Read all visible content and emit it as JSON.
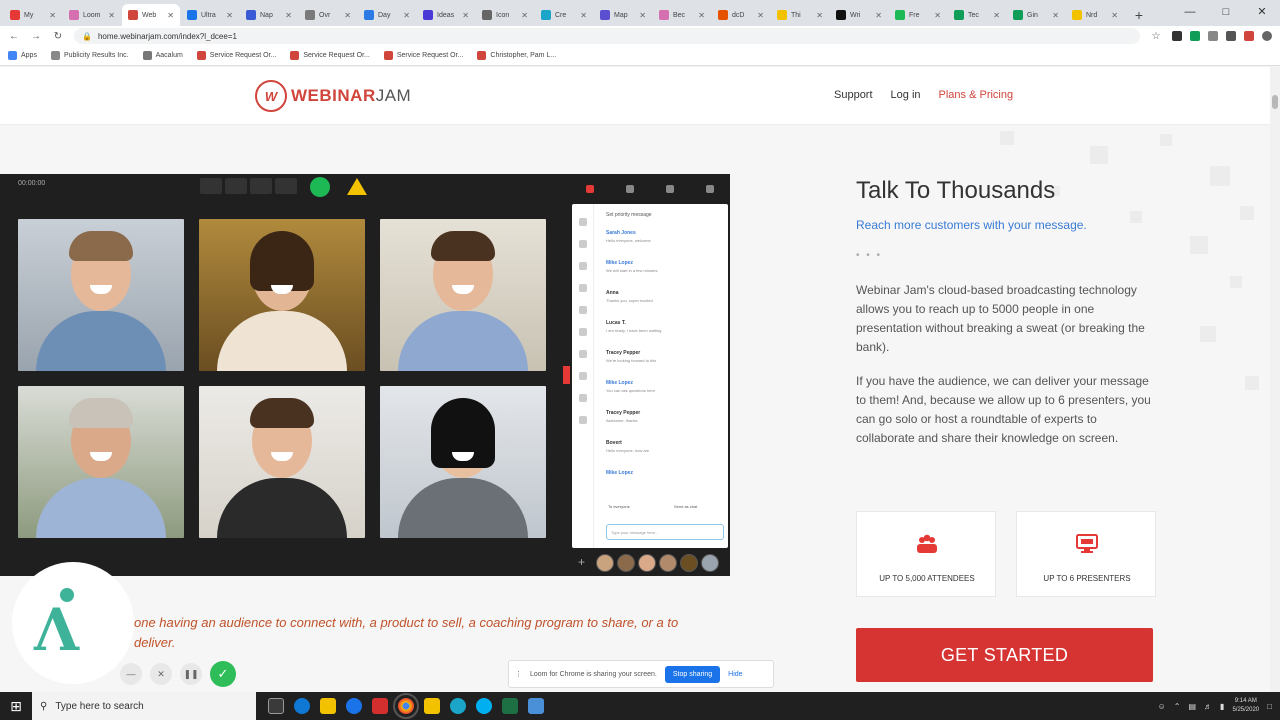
{
  "browser": {
    "tabs": [
      {
        "label": "My",
        "color": "#e53935"
      },
      {
        "label": "Loom",
        "color": "#d66fb0"
      },
      {
        "label": "Web",
        "color": "#d0453c",
        "active": true
      },
      {
        "label": "Ultra",
        "color": "#1a73e8"
      },
      {
        "label": "Nap",
        "color": "#3a5bd5"
      },
      {
        "label": "Ovr",
        "color": "#7a7a7a"
      },
      {
        "label": "Day",
        "color": "#2c7be5"
      },
      {
        "label": "Ideas",
        "color": "#4a3ad5"
      },
      {
        "label": "Icon",
        "color": "#666666"
      },
      {
        "label": "Cre",
        "color": "#1aa5c9"
      },
      {
        "label": "Map",
        "color": "#5a4fcf"
      },
      {
        "label": "Bec",
        "color": "#d66fb0"
      },
      {
        "label": "dcD",
        "color": "#e65100"
      },
      {
        "label": "Thi",
        "color": "#f2c200"
      },
      {
        "label": "Wri",
        "color": "#111111"
      },
      {
        "label": "Fre",
        "color": "#1db954"
      },
      {
        "label": "Tec",
        "color": "#0f9d58"
      },
      {
        "label": "Gin",
        "color": "#0f9d58"
      },
      {
        "label": "Nrd",
        "color": "#f2c200"
      }
    ],
    "new_tab": "+",
    "url": "home.webinarjam.com/index?l_dcee=1",
    "bookmarks": [
      {
        "label": "Apps",
        "color": "#4285f4"
      },
      {
        "label": "Publicity Results Inc.",
        "color": "#888888"
      },
      {
        "label": "Aacalum",
        "color": "#777777"
      },
      {
        "label": "Service Request Or...",
        "color": "#d0453c"
      },
      {
        "label": "Service Request Or...",
        "color": "#d0453c"
      },
      {
        "label": "Service Request Or...",
        "color": "#d0453c"
      },
      {
        "label": "Christopher, Pam L...",
        "color": "#d0453c"
      }
    ]
  },
  "site": {
    "logo_mark": "W",
    "logo_word_1": "WEBINAR",
    "logo_word_2": "JAM",
    "nav": {
      "support": "Support",
      "login": "Log in",
      "pricing": "Plans & Pricing"
    }
  },
  "app_mock": {
    "timer": "00:00:00",
    "chat_header": "Set priority message",
    "messages": [
      {
        "name": "Sarah Jones",
        "text": "Hello everyone, welcome",
        "blue": true
      },
      {
        "name": "Mike Lopez",
        "text": "We will start in a few minutes",
        "blue": true
      },
      {
        "name": "Anna",
        "text": "Thanks you, super excited",
        "blue": false
      },
      {
        "name": "Lucas T.",
        "text": "I am ready, I have been waiting",
        "blue": false
      },
      {
        "name": "Tracey Pepper",
        "text": "We're looking forward to this",
        "blue": false
      },
      {
        "name": "Mike Lopez",
        "text": "You can ask questions here",
        "blue": true
      },
      {
        "name": "Tracey Pepper",
        "text": "Awesome, thanks",
        "blue": false
      },
      {
        "name": "Bovert",
        "text": "Hello everyone, how are",
        "blue": false
      },
      {
        "name": "Mike Lopez",
        "text": "",
        "blue": true
      }
    ],
    "select_1": "To everyone",
    "select_2": "Send as chat",
    "chat_input": "Type your message here..."
  },
  "hero": {
    "title": "Talk To Thousands",
    "subtitle": "Reach more customers with your message.",
    "dots": "• • •",
    "para1": "Webinar Jam's cloud-based broadcasting technology allows you to reach up to 5000 people in one presentation without breaking a sweat (or breaking the bank).",
    "para2": "If you have the audience, we can deliver your message to them! And, because we allow up to 6 presenters, you can go solo or host a roundtable of experts to collaborate and share their knowledge on screen.",
    "feature1": "UP TO 5,000 ATTENDEES",
    "feature2": "UP TO 6 PRESENTERS",
    "cta": "GET STARTED",
    "tagline": "one having an audience to connect with, a product to sell, a coaching program to share, or a to deliver."
  },
  "recorder": {
    "share_text": "Loom for Chrome is sharing your screen.",
    "stop_label": "Stop sharing",
    "hide_label": "Hide"
  },
  "taskbar": {
    "search_placeholder": "Type here to search",
    "time": "9:14 AM",
    "date": "5/25/2020"
  },
  "colors": {
    "brand_red": "#d63333",
    "link_blue": "#3a7bd5",
    "tagline_orange": "#c0522a"
  }
}
